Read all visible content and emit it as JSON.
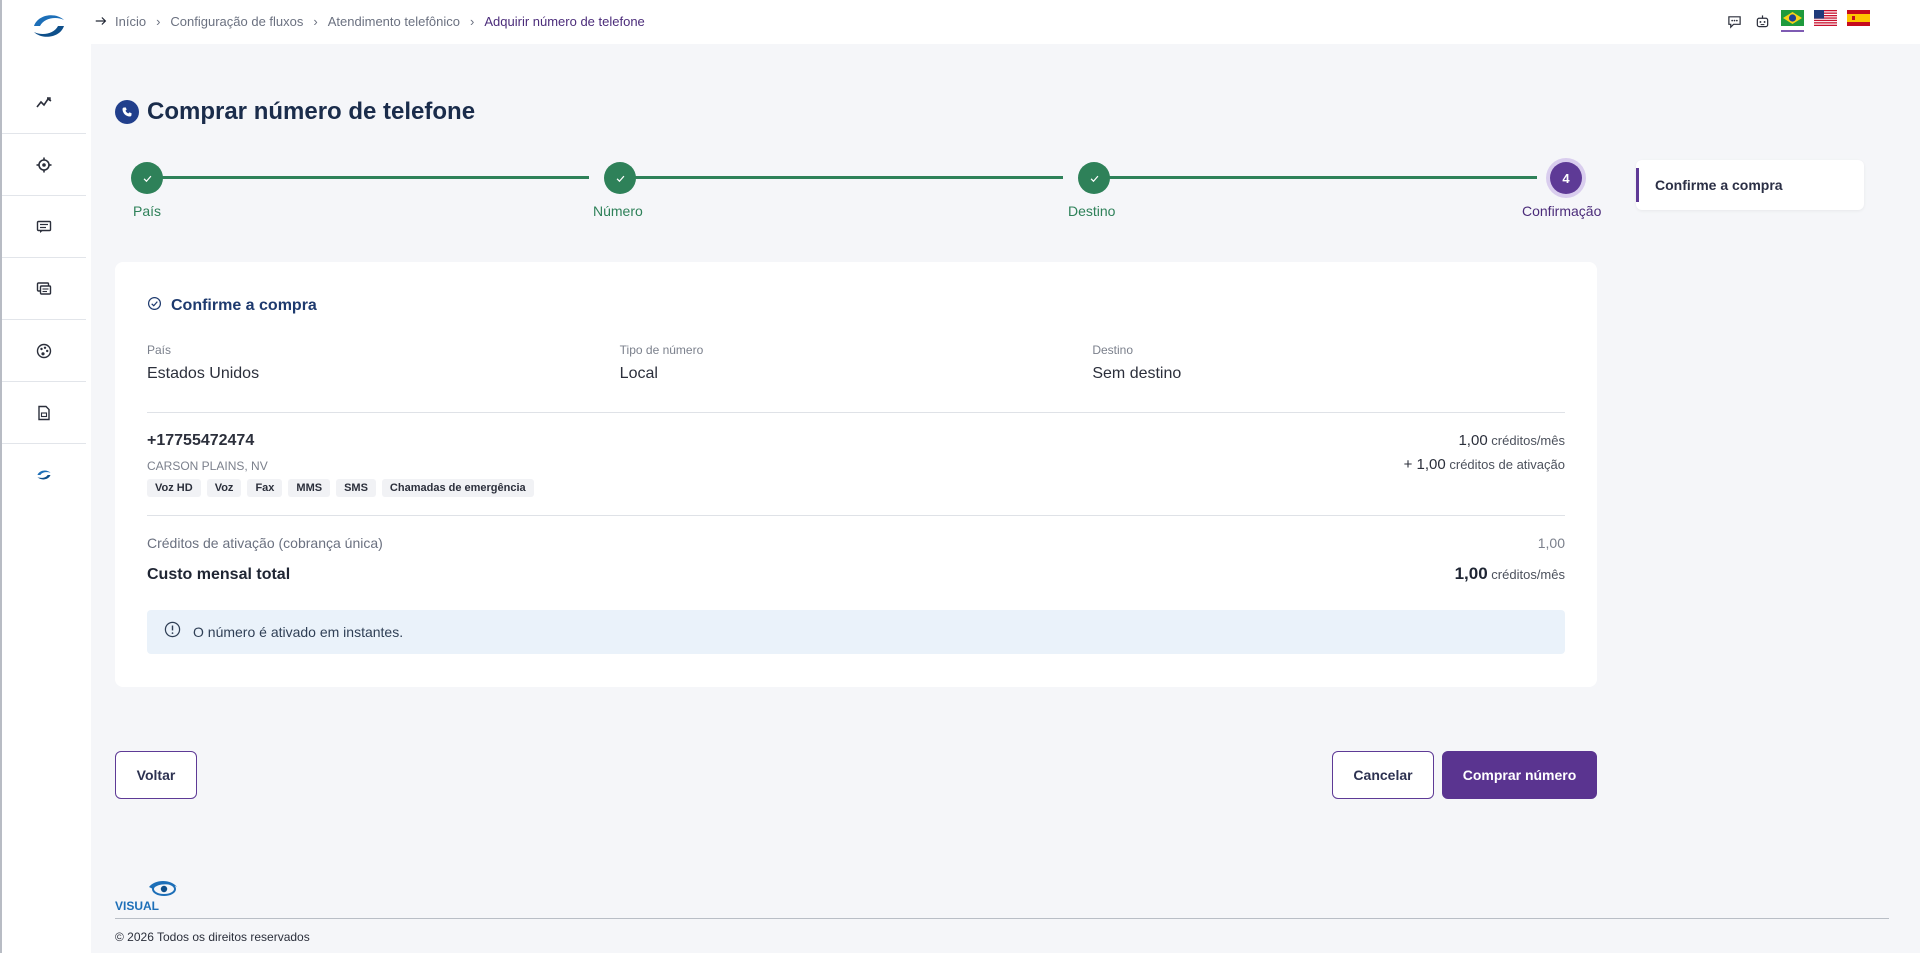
{
  "breadcrumb": [
    {
      "label": "Início"
    },
    {
      "label": "Configuração de fluxos"
    },
    {
      "label": "Atendimento telefônico"
    },
    {
      "label": "Adquirir número de telefone"
    }
  ],
  "page": {
    "title": "Comprar número de telefone"
  },
  "stepper": {
    "steps": [
      {
        "label": "País",
        "status": "done"
      },
      {
        "label": "Número",
        "status": "done"
      },
      {
        "label": "Destino",
        "status": "done"
      },
      {
        "label": "Confirmação",
        "status": "active",
        "number": "4"
      }
    ]
  },
  "aside": {
    "item": "Confirme a compra"
  },
  "card": {
    "heading": "Confirme a compra",
    "country_label": "País",
    "country_value": "Estados Unidos",
    "type_label": "Tipo de número",
    "type_value": "Local",
    "dest_label": "Destino",
    "dest_value": "Sem destino",
    "number": "+17755472474",
    "location": "CARSON PLAINS, NV",
    "capabilities": [
      "Voz HD",
      "Voz",
      "Fax",
      "MMS",
      "SMS",
      "Chamadas de emergência"
    ],
    "monthly_price": "1,00",
    "monthly_unit": "créditos/mês",
    "activation_prefix": "+ 1,00",
    "activation_unit": "créditos de ativação",
    "activation_row_label": "Créditos de ativação (cobrança única)",
    "activation_row_value": "1,00",
    "total_label": "Custo mensal total",
    "total_value": "1,00",
    "total_unit": "créditos/mês",
    "notice": "O número é ativado em instantes."
  },
  "buttons": {
    "back": "Voltar",
    "cancel": "Cancelar",
    "buy": "Comprar número"
  },
  "footer": {
    "logo_text": "VISUAL",
    "copyright": "© 2026 Todos os direitos reservados"
  },
  "colors": {
    "primary": "#5a3490",
    "success": "#2e8159",
    "navy": "#1a2c4b"
  }
}
